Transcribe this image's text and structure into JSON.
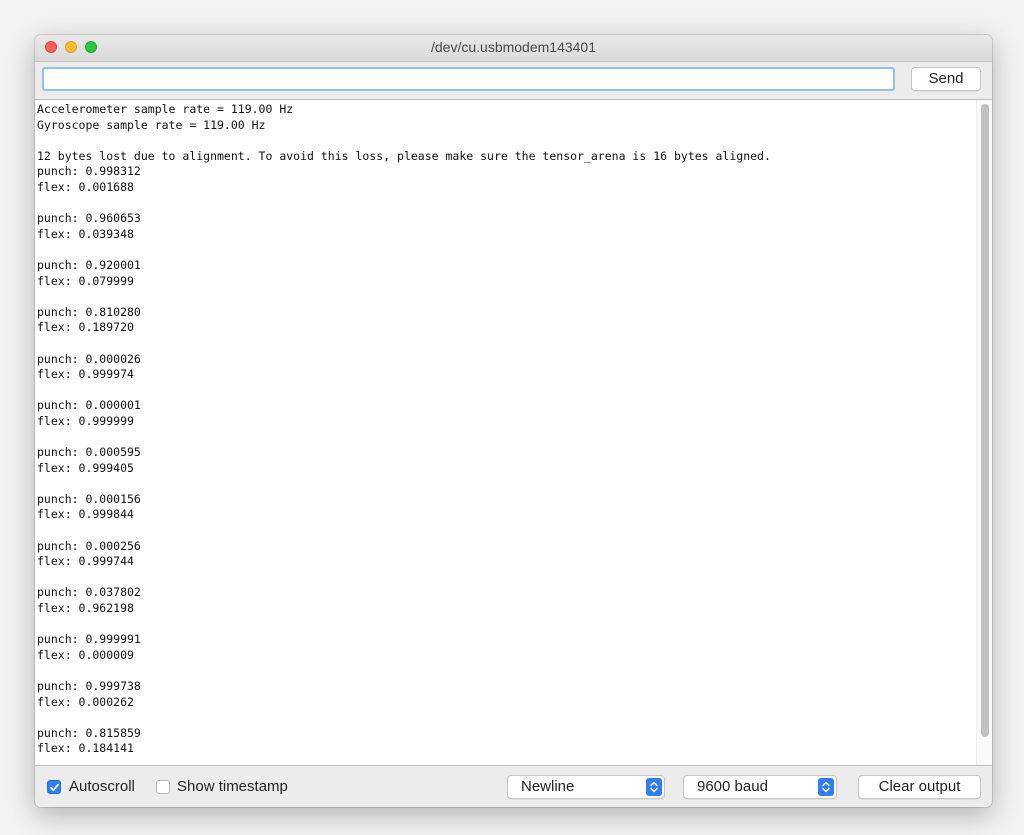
{
  "window": {
    "title": "/dev/cu.usbmodem143401"
  },
  "send_bar": {
    "input_value": "",
    "send_label": "Send"
  },
  "output": {
    "lines": [
      "Accelerometer sample rate = 119.00 Hz",
      "Gyroscope sample rate = 119.00 Hz",
      "",
      "12 bytes lost due to alignment. To avoid this loss, please make sure the tensor_arena is 16 bytes aligned.",
      "punch: 0.998312",
      "flex: 0.001688",
      "",
      "punch: 0.960653",
      "flex: 0.039348",
      "",
      "punch: 0.920001",
      "flex: 0.079999",
      "",
      "punch: 0.810280",
      "flex: 0.189720",
      "",
      "punch: 0.000026",
      "flex: 0.999974",
      "",
      "punch: 0.000001",
      "flex: 0.999999",
      "",
      "punch: 0.000595",
      "flex: 0.999405",
      "",
      "punch: 0.000156",
      "flex: 0.999844",
      "",
      "punch: 0.000256",
      "flex: 0.999744",
      "",
      "punch: 0.037802",
      "flex: 0.962198",
      "",
      "punch: 0.999991",
      "flex: 0.000009",
      "",
      "punch: 0.999738",
      "flex: 0.000262",
      "",
      "punch: 0.815859",
      "flex: 0.184141"
    ]
  },
  "footer": {
    "autoscroll_label": "Autoscroll",
    "autoscroll_checked": true,
    "timestamp_label": "Show timestamp",
    "timestamp_checked": false,
    "line_ending": "Newline",
    "baud_rate": "9600 baud",
    "clear_label": "Clear output"
  },
  "colors": {
    "accent": "#2f7ef6",
    "close": "#fe5f57",
    "minimize": "#febc2e",
    "zoom": "#28c840"
  }
}
